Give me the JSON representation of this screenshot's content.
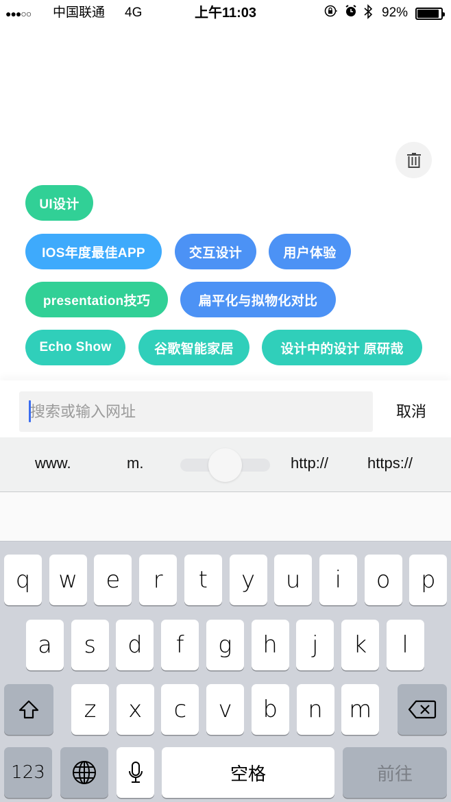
{
  "status_bar": {
    "signal": "●●●○○",
    "carrier": "中国联通",
    "network": "4G",
    "time": "上午11:03",
    "orientation_lock_icon": "rotation-lock-icon",
    "alarm_icon": "alarm-icon",
    "bluetooth_icon": "bluetooth-icon",
    "battery_percent": "92%",
    "battery_level": 0.92
  },
  "history": {
    "clear_icon": "trash-icon",
    "tags": [
      {
        "label": "UI设计",
        "color": "#31d096"
      },
      {
        "label": "IOS年度最佳APP",
        "color": "#3eaafc"
      },
      {
        "label": "交互设计",
        "color": "#4c92f5"
      },
      {
        "label": "用户体验",
        "color": "#4c92f5"
      },
      {
        "label": "presentation技巧",
        "color": "#31d096"
      },
      {
        "label": "扁平化与拟物化对比",
        "color": "#4c92f5"
      },
      {
        "label": "Echo Show",
        "color": "#30cfba"
      },
      {
        "label": "谷歌智能家居",
        "color": "#30cfba"
      },
      {
        "label": "设计中的设计 原研哉",
        "color": "#30cfba"
      }
    ]
  },
  "search": {
    "value": "",
    "placeholder": "搜索或输入网址",
    "cancel_label": "取消",
    "caret_color": "#3b6df0"
  },
  "shortcuts": {
    "items": [
      "www.",
      "m.",
      "http://",
      "https://"
    ]
  },
  "keyboard": {
    "row1": [
      "q",
      "w",
      "e",
      "r",
      "t",
      "y",
      "u",
      "i",
      "o",
      "p"
    ],
    "row2": [
      "a",
      "s",
      "d",
      "f",
      "g",
      "h",
      "j",
      "k",
      "l"
    ],
    "row3": [
      "z",
      "x",
      "c",
      "v",
      "b",
      "n",
      "m"
    ],
    "shift_icon": "shift-icon",
    "backspace_icon": "backspace-icon",
    "numbers_label": "123",
    "globe_icon": "globe-icon",
    "mic_icon": "microphone-icon",
    "space_label": "空格",
    "go_label": "前往"
  }
}
